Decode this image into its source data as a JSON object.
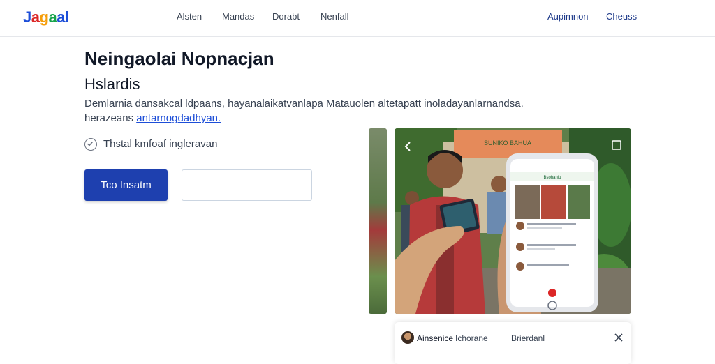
{
  "header": {
    "logo": [
      "J",
      "a",
      "g",
      "a",
      "al"
    ],
    "nav": [
      "Alsten",
      "Mandas",
      "Dorabt",
      "Nenfall"
    ],
    "actions": [
      "Aupimnon",
      "Cheuss"
    ]
  },
  "hero": {
    "title": "Neingaolai Nopnacjan",
    "subtitle": "Hslardis",
    "description": "Demlarnia  dansakcal ldpaans, hayanalaikatvanlapa Matauolen altetapatt inoladayanlarnandsa.",
    "description_line2_prefix": "herazeans",
    "description_link": "antarnogdadhyan.",
    "check_label": "Thstal kmfoaf ingleravan",
    "primary_button": "Tco Insatm",
    "input_value": ""
  },
  "photo": {
    "phone_header": "Bsohaniu",
    "sign_text": "SUNIKO BAHUA"
  },
  "bottom_panel": {
    "name": "Ainsenice",
    "handle": "Ichorane",
    "status": "Brierdanl"
  },
  "colors": {
    "brand": "#1e40af",
    "link": "#1d4ed8"
  }
}
